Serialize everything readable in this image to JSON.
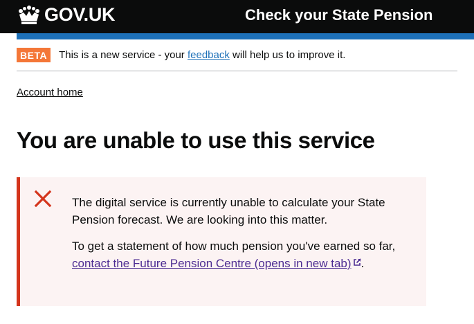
{
  "header": {
    "logo_text": "GOV.UK",
    "service_name": "Check your State Pension"
  },
  "phase_banner": {
    "tag": "BETA",
    "text_before": "This is a new service - your ",
    "link": "feedback",
    "text_after": " will help us to improve it."
  },
  "nav": {
    "back_link": "Account home"
  },
  "page": {
    "title": "You are unable to use this service"
  },
  "error": {
    "paragraph1": "The digital service is currently unable to calculate your State Pension forecast. We are looking into this matter.",
    "paragraph2_before": "To get a statement of how much pension you've earned so far, ",
    "paragraph2_link": "contact the Future Pension Centre (opens in new tab)",
    "paragraph2_after": "."
  },
  "icons": {
    "logo": "crown-icon",
    "error": "cross-icon",
    "external": "external-link-icon"
  },
  "colors": {
    "header_bg": "#0b0c0c",
    "brand_blue": "#1d70b8",
    "beta_tag": "#f47738",
    "error_red": "#d4351c",
    "panel_bg": "#fcf3f3",
    "visited_link": "#4c2c92"
  }
}
